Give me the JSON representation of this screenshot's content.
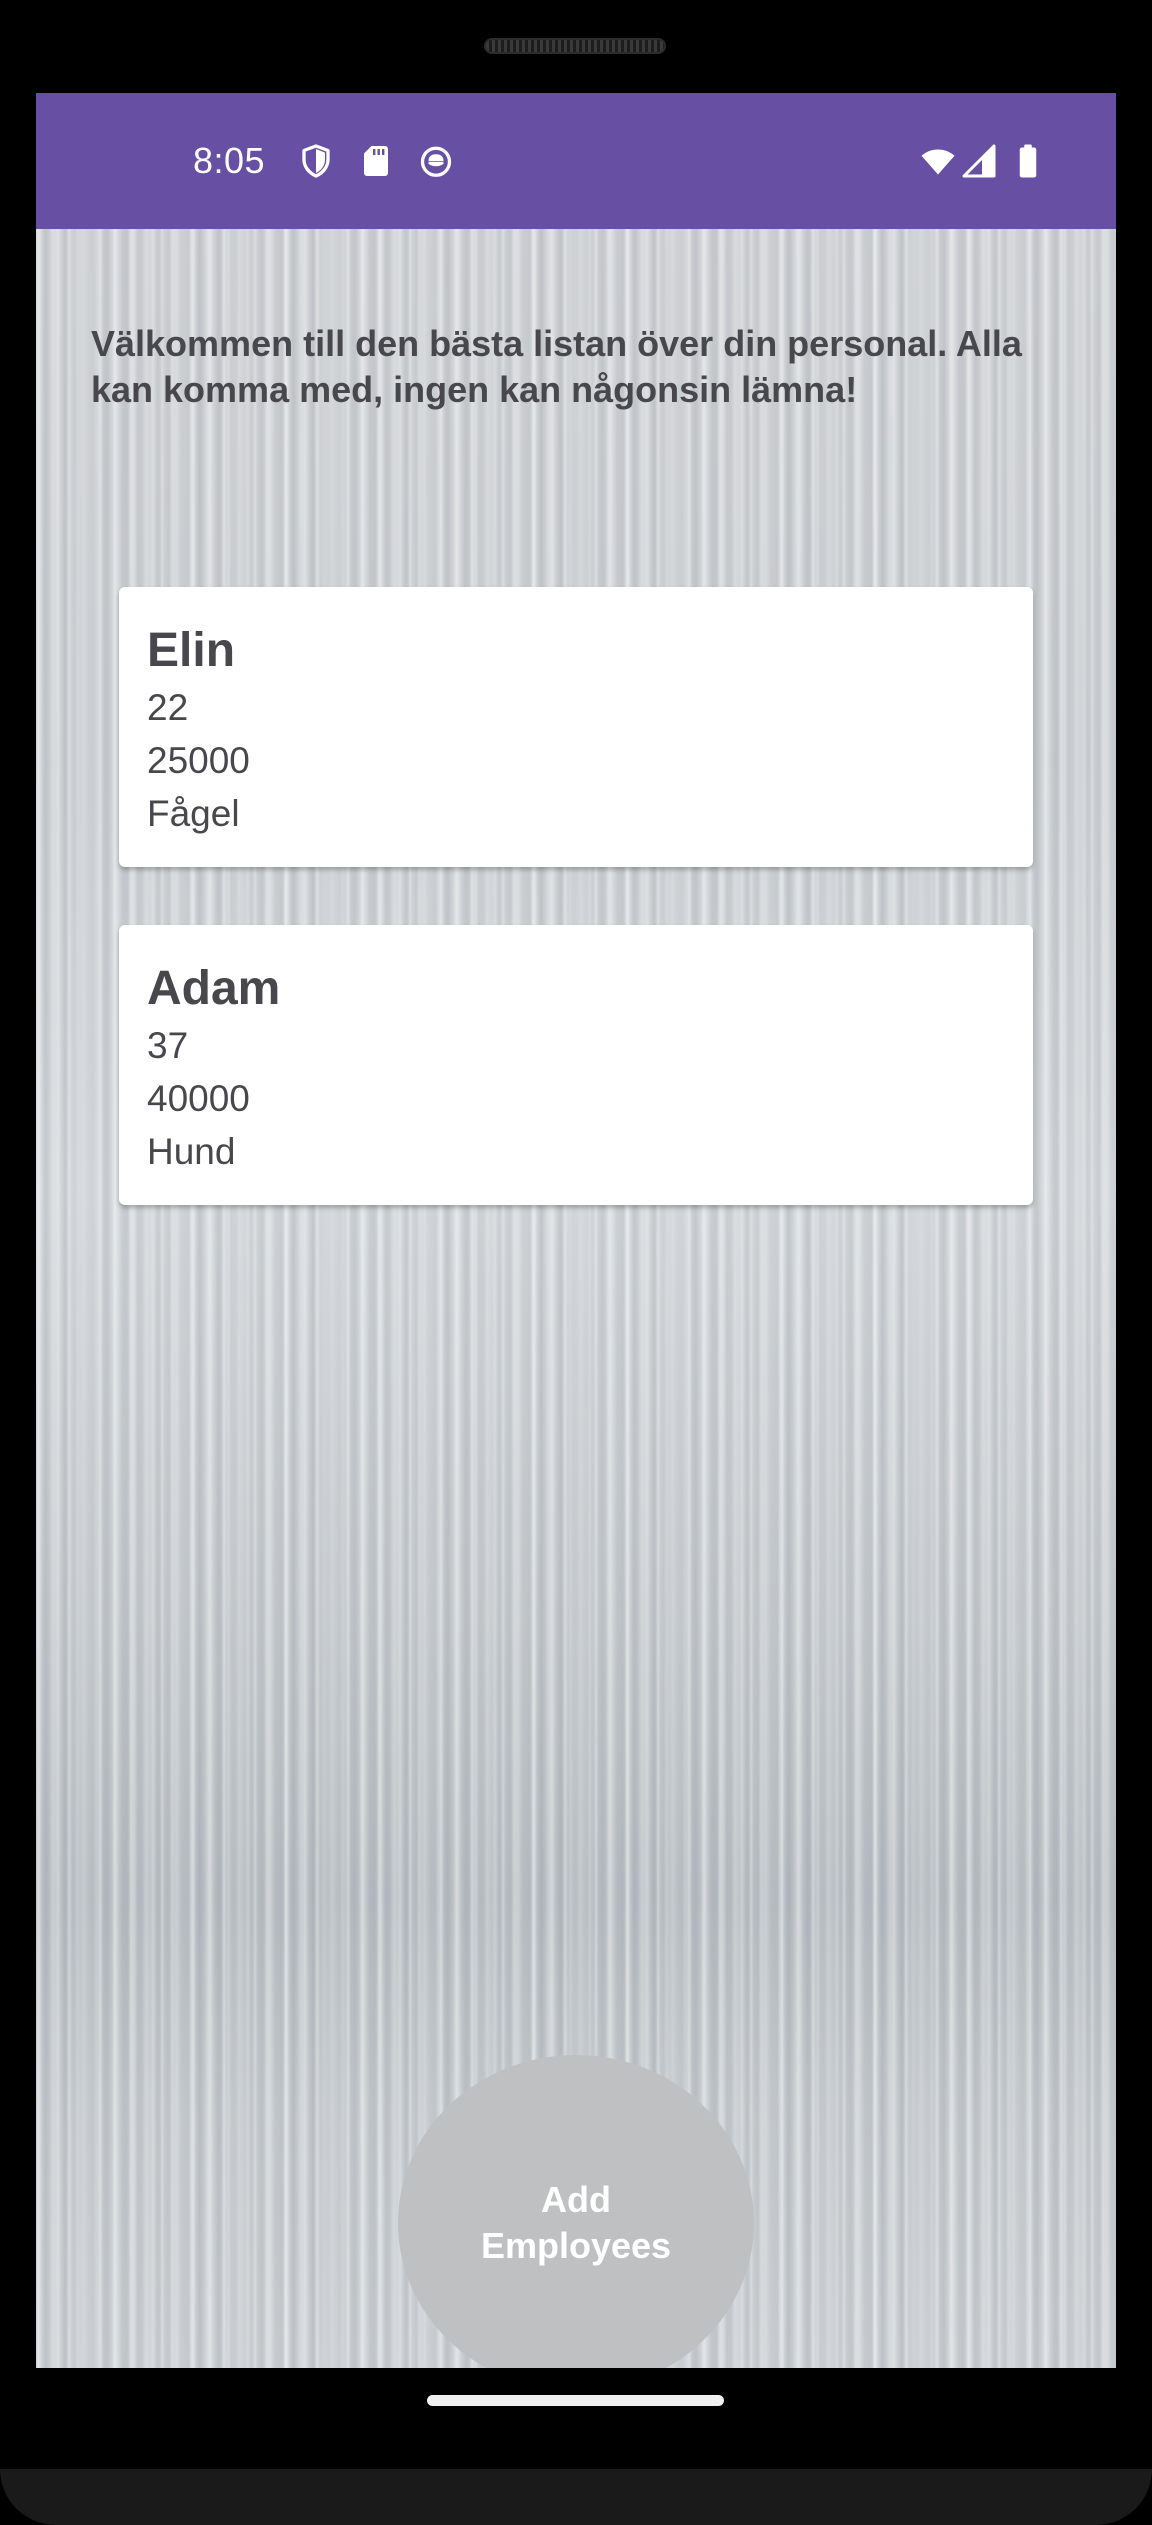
{
  "status_bar": {
    "time": "8:05",
    "color": "#6750a4",
    "left_icons": [
      "shield-icon",
      "sd-card-icon",
      "cat-face-icon"
    ],
    "right_icons": [
      "wifi-icon",
      "cell-signal-icon",
      "battery-icon"
    ]
  },
  "main": {
    "welcome_text": "Välkommen till den bästa listan över din personal. Alla kan komma med, ingen kan någonsin lämna!",
    "employees": [
      {
        "name": "Elin",
        "age": "22",
        "salary": "25000",
        "animal": "Fågel"
      },
      {
        "name": "Adam",
        "age": "37",
        "salary": "40000",
        "animal": "Hund"
      }
    ],
    "fab": {
      "line1": "Add",
      "line2": "Employees"
    }
  }
}
